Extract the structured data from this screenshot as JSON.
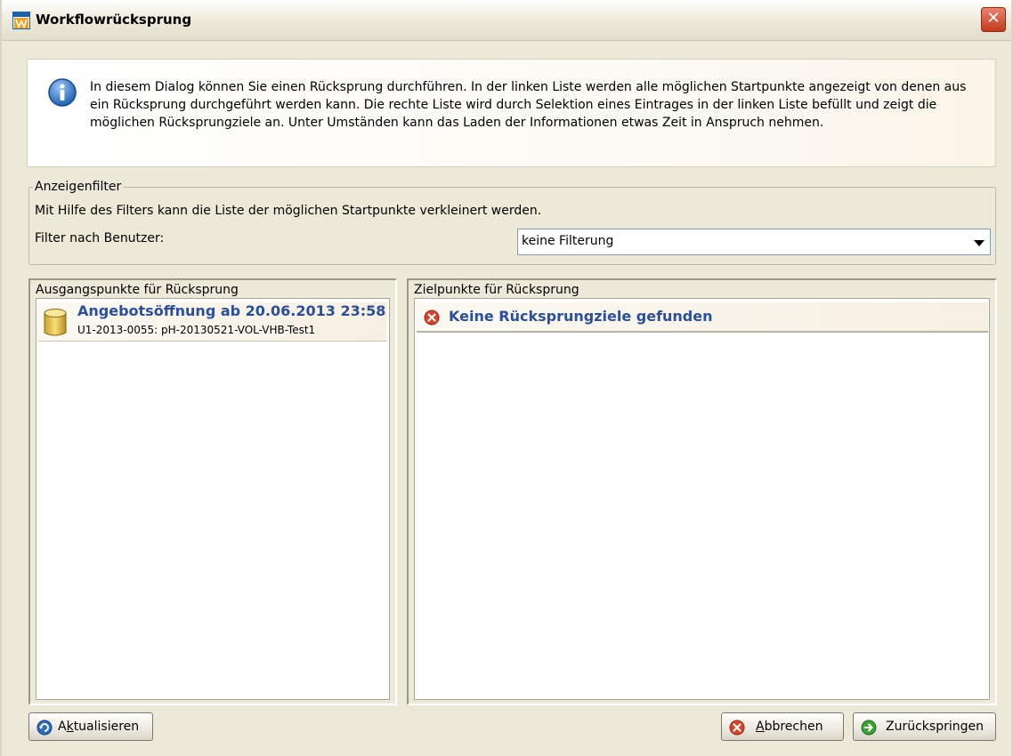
{
  "window": {
    "title": "Workflowrücksprung",
    "close_symbol": "✕",
    "app_icon": "workflow-app-icon"
  },
  "info": {
    "icon": "info-icon",
    "text": "In diesem Dialog können Sie einen Rücksprung durchführen. In der linken Liste werden alle möglichen Startpunkte angezeigt von denen aus ein Rücksprung durchgeführt werden kann. Die rechte Liste wird durch Selektion eines Eintrages in der linken Liste befüllt und zeigt die möglichen Rücksprungziele an. Unter Umständen kann das Laden der Informationen etwas Zeit in Anspruch nehmen."
  },
  "filter": {
    "legend": "Anzeigenfilter",
    "description": "Mit Hilfe des Filters kann die Liste der möglichen Startpunkte verkleinert werden.",
    "label": "Filter nach Benutzer:",
    "selected": "keine Filterung"
  },
  "left_panel": {
    "legend": "Ausgangspunkte für Rücksprung",
    "items": [
      {
        "title": "Angebotsöffnung ab 20.06.2013 23:58",
        "subtitle": "U1-2013-0055: pH-20130521-VOL-VHB-Test1",
        "icon": "database-icon"
      }
    ]
  },
  "right_panel": {
    "legend": "Zielpunkte für Rücksprung",
    "items": [
      {
        "text": "Keine Rücksprungziele gefunden",
        "icon": "error-icon"
      }
    ]
  },
  "buttons": {
    "refresh_a": "A",
    "refresh_k": "k",
    "refresh_rest": "tualisieren",
    "cancel_a": "A",
    "cancel_rest": "bbrechen",
    "back_label": "Zurückspringen"
  },
  "colors": {
    "accent_text": "#2b4f9c",
    "dialog_bg": "#ece9d8",
    "close_red": "#c4391c"
  }
}
